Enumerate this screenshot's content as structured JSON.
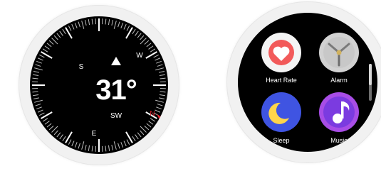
{
  "compass": {
    "bearing": "31°",
    "heading_direction": "SW",
    "cardinals": {
      "north": "N",
      "south": "S",
      "east": "E",
      "west": "W"
    },
    "colors": {
      "needle": "#e01f2b",
      "north": "#e01f2b",
      "background": "#000000"
    }
  },
  "apps": {
    "items": [
      {
        "label": "Heart Rate",
        "icon": "heart-icon"
      },
      {
        "label": "Alarm",
        "icon": "clock-icon"
      },
      {
        "label": "Sleep",
        "icon": "moon-icon"
      },
      {
        "label": "Music",
        "icon": "music-note-icon"
      }
    ],
    "colors": {
      "heart": "#f25a5a",
      "alarm": "#c9c9c9",
      "sleep": "#3f54e2",
      "music": "#a84de6"
    }
  }
}
